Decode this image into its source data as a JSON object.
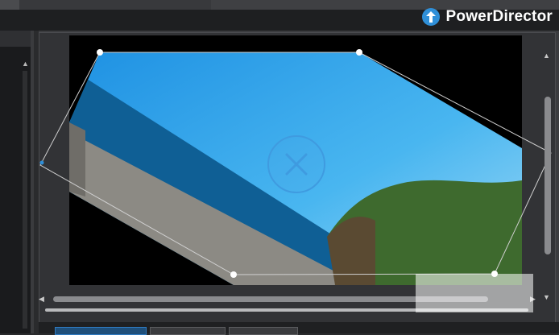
{
  "app": {
    "brand_title": "PowerDirector"
  },
  "preview": {
    "transform_tool": "move-rotate",
    "center_handle_icon": "crosshair-icon"
  },
  "colors": {
    "sky_top": "#1f8fe0",
    "sky_bottom": "#8fd2f5",
    "sea": "#0f5f95",
    "sand": "#8c8a84",
    "hill": "#3e6a2e",
    "accent": "#2f8fd8"
  },
  "bottom_bar": {
    "buttons": [
      "",
      "",
      "",
      ""
    ]
  }
}
